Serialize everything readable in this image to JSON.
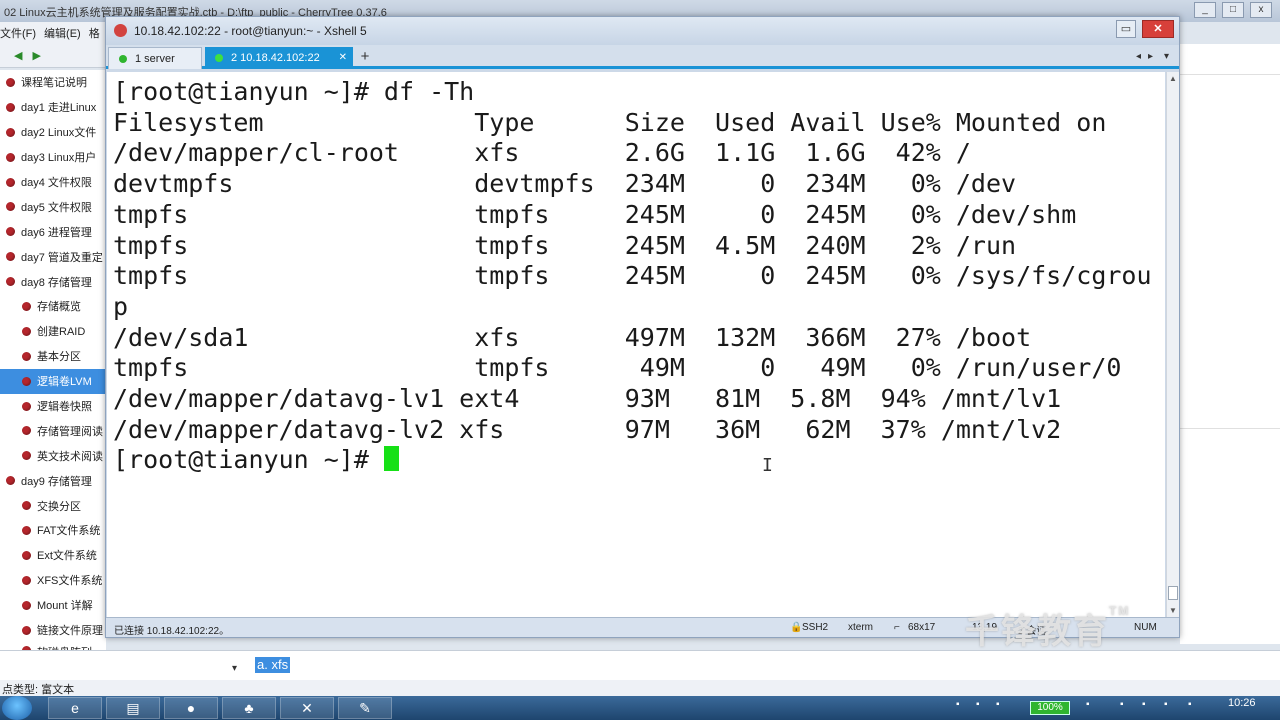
{
  "bg_window": {
    "title": "02 Linux云主机系统管理及服务配置实战.ctb - D:\\ftp_public - CherryTree 0.37.6",
    "menu": [
      "文件(F)",
      "编辑(E)",
      "格"
    ],
    "toolbar_icons": [
      "arrow-left-icon",
      "arrow-right-icon"
    ],
    "win_buttons": [
      "_",
      "□",
      "x"
    ]
  },
  "tree": {
    "items": [
      {
        "label": "课程笔记说明",
        "level": 0
      },
      {
        "label": "day1 走进Linux",
        "level": 0
      },
      {
        "label": "day2 Linux文件",
        "level": 0
      },
      {
        "label": "day3 Linux用户",
        "level": 0
      },
      {
        "label": "day4 文件权限",
        "level": 0
      },
      {
        "label": "day5 文件权限",
        "level": 0
      },
      {
        "label": "day6 进程管理",
        "level": 0
      },
      {
        "label": "day7 管道及重定",
        "level": 0
      },
      {
        "label": "day8 存储管理",
        "level": 0
      },
      {
        "label": "存储概览",
        "level": 1
      },
      {
        "label": "创建RAID",
        "level": 1
      },
      {
        "label": "基本分区",
        "level": 1
      },
      {
        "label": "逻辑卷LVM",
        "level": 1,
        "selected": true
      },
      {
        "label": "逻辑卷快照",
        "level": 1
      },
      {
        "label": "存储管理阅读",
        "level": 1
      },
      {
        "label": "英文技术阅读",
        "level": 1
      },
      {
        "label": "day9 存储管理",
        "level": 0
      },
      {
        "label": "交换分区",
        "level": 1
      },
      {
        "label": "FAT文件系统",
        "level": 1
      },
      {
        "label": "Ext文件系统",
        "level": 1
      },
      {
        "label": "XFS文件系统",
        "level": 1
      },
      {
        "label": "Mount 详解",
        "level": 1
      },
      {
        "label": "链接文件原理",
        "level": 1
      },
      {
        "label": "软磁盘阵列RAID【扩展】",
        "level": 1
      }
    ]
  },
  "editor": {
    "selected_text": "a. xfs",
    "status_text": "点类型: 富文本"
  },
  "xshell": {
    "title": "10.18.42.102:22 - root@tianyun:~ - Xshell 5",
    "tabs": [
      {
        "label": "1 server",
        "active": false
      },
      {
        "label": "2 10.18.42.102:22",
        "active": true
      }
    ],
    "add_tab": "+",
    "terminal_lines": [
      "[root@tianyun ~]# df -Th",
      "Filesystem              Type      Size  Used Avail Use% Mounted on",
      "/dev/mapper/cl-root     xfs       2.6G  1.1G  1.6G  42% /",
      "devtmpfs                devtmpfs  234M     0  234M   0% /dev",
      "tmpfs                   tmpfs     245M     0  245M   0% /dev/shm",
      "tmpfs                   tmpfs     245M  4.5M  240M   2% /run",
      "tmpfs                   tmpfs     245M     0  245M   0% /sys/fs/cgrou",
      "p",
      "/dev/sda1               xfs       497M  132M  366M  27% /boot",
      "tmpfs                   tmpfs      49M     0   49M   0% /run/user/0",
      "/dev/mapper/datavg-lv1 ext4       93M   81M  5.8M  94% /mnt/lv1",
      "/dev/mapper/datavg-lv2 xfs        97M   36M   62M  37% /mnt/lv2"
    ],
    "prompt": "[root@tianyun ~]# ",
    "status": {
      "connected": "已连接 10.18.42.102:22。",
      "protocol": "SSH2",
      "term": "xterm",
      "size": "68x17",
      "pos": "13,19",
      "sessions": "2 会话",
      "num": "NUM"
    }
  },
  "watermark": {
    "text": "千锋教育",
    "tm": "TM"
  },
  "taskbar": {
    "battery": "100%",
    "time": "10:26"
  }
}
